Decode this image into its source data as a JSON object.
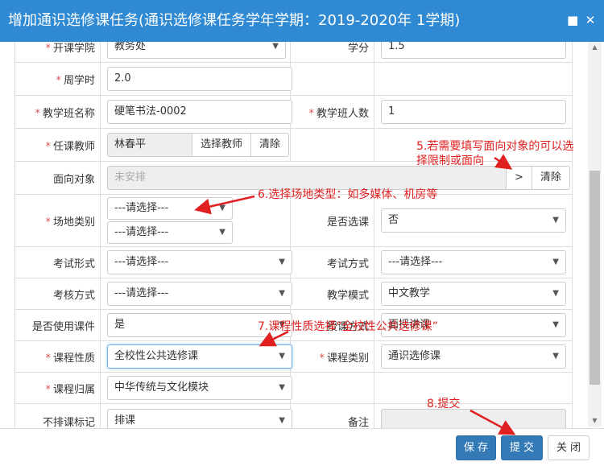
{
  "window": {
    "title": "增加通识选修课任务(通识选修课任务学年学期：2019-2020年 1学期)",
    "maximize_icon": "■",
    "close_icon": "✕"
  },
  "form": {
    "row_college": {
      "label": "开课学院",
      "value": "教务处",
      "label2": "学分",
      "value2": "1.5"
    },
    "row_hours": {
      "label": "周学时",
      "value": "2.0"
    },
    "row_class": {
      "label": "教学班名称",
      "value": "硬笔书法-0002",
      "label2": "教学班人数",
      "value2": "1"
    },
    "row_teacher": {
      "label": "任课教师",
      "value": "林春平",
      "btn_choose": "选择教师",
      "btn_clear": "清除"
    },
    "row_target": {
      "label": "面向对象",
      "value": "未安排",
      "btn_more": ">",
      "btn_clear": "清除"
    },
    "row_venue": {
      "label": "场地类别",
      "value": "---请选择---",
      "value_b": "---请选择---",
      "label2": "是否选课",
      "value2": "否"
    },
    "row_exam": {
      "label": "考试形式",
      "value": "---请选择---",
      "label2": "考试方式",
      "value2": "---请选择---"
    },
    "row_assess": {
      "label": "考核方式",
      "value": "---请选择---",
      "label2": "教学模式",
      "value2": "中文教学"
    },
    "row_courseware": {
      "label": "是否使用课件",
      "value": "是",
      "label2": "授课方式",
      "value2": "面授讲课"
    },
    "row_nature": {
      "label": "课程性质",
      "value": "全校性公共选修课",
      "label2": "课程类别",
      "value2": "通识选修课"
    },
    "row_belong": {
      "label": "课程归属",
      "value": "中华传统与文化模块"
    },
    "row_noschedule": {
      "label": "不排课标记",
      "value": "排课",
      "label2": "备注",
      "value2": ""
    }
  },
  "annotations": {
    "note5_line1": "5.若需要填写面向对象的可以选",
    "note5_line2": "择限制或面向",
    "note6": "6.选择场地类型：如多媒体、机房等",
    "note7": "7.课程性质选择“全校性公共选修课”",
    "note8": "8.提交"
  },
  "footer": {
    "save": "保 存",
    "submit": "提 交",
    "close": "关 闭"
  },
  "colors": {
    "titlebar": "#2f8ad3",
    "primary_button": "#337ab7",
    "annotation": "#e02020",
    "required": "#d9534f"
  }
}
